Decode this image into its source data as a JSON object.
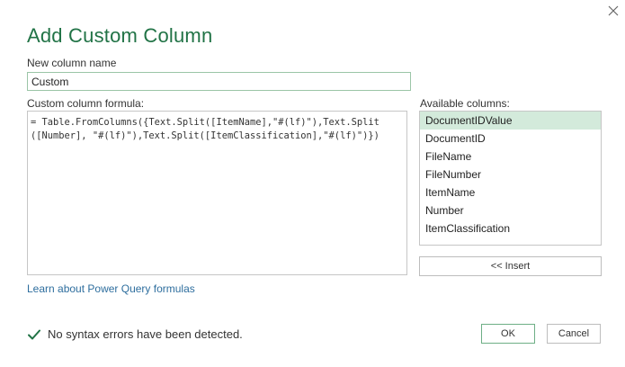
{
  "dialog": {
    "title": "Add Custom Column",
    "close_icon": "close-icon"
  },
  "new_column": {
    "label": "New column name",
    "value": "Custom"
  },
  "formula": {
    "label": "Custom column formula:",
    "line1": "= Table.FromColumns({Text.Split([ItemName],\"#(lf)\"),Text.Split",
    "line2": "([Number], \"#(lf)\"),Text.Split([ItemClassification],\"#(lf)\")})"
  },
  "available_columns": {
    "label": "Available columns:",
    "items": [
      "DocumentIDValue",
      "DocumentID",
      "FileName",
      "FileNumber",
      "ItemName",
      "Number",
      "ItemClassification"
    ],
    "selected": "DocumentIDValue"
  },
  "insert_button": "<< Insert",
  "learn_link": "Learn about Power Query formulas",
  "status": {
    "icon": "checkmark-icon",
    "text": "No syntax errors have been detected.",
    "color": "#217346"
  },
  "buttons": {
    "ok": "OK",
    "cancel": "Cancel"
  },
  "colors": {
    "accent": "#217346",
    "selection": "#d3eadb",
    "link": "#2e6e9e"
  }
}
